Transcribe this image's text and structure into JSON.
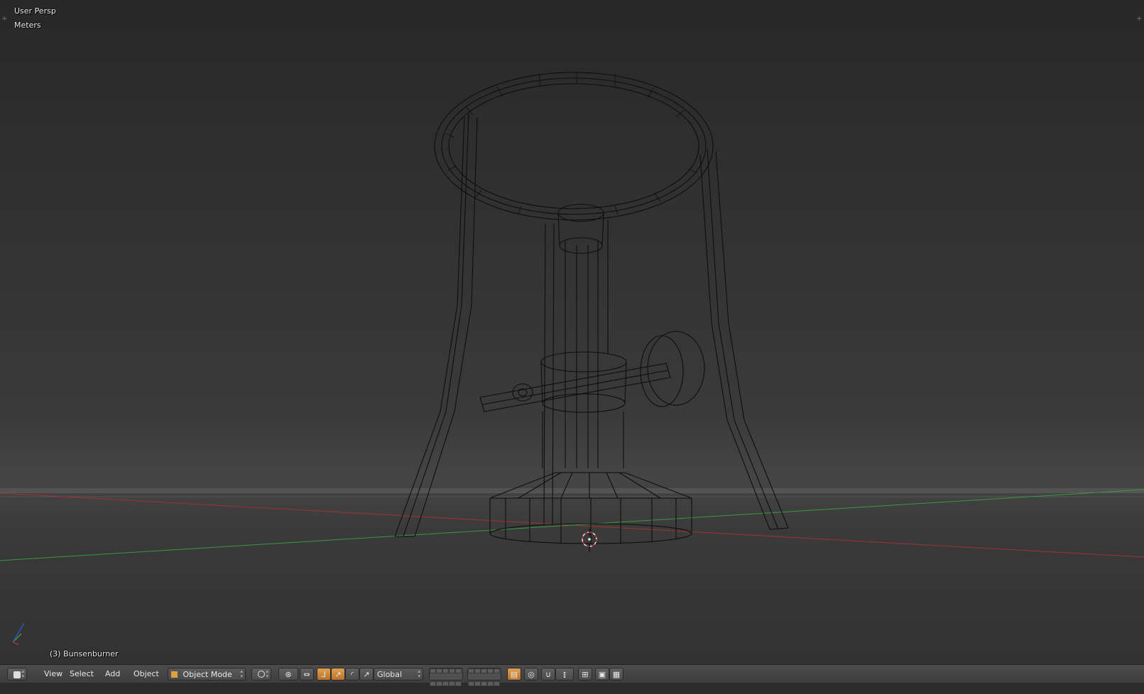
{
  "viewport": {
    "view_name": "User Persp",
    "units": "Meters",
    "selected_object": "(3) Bunsenburner",
    "axis_colors": {
      "x": "#b03030",
      "y": "#3fa03f",
      "z": "#3050c0"
    }
  },
  "header": {
    "editor_type_icon": "3d-viewport-icon",
    "menus": {
      "view": "View",
      "select": "Select",
      "add": "Add",
      "object": "Object"
    },
    "mode": {
      "label": "Object Mode",
      "icon": "cube-icon"
    },
    "viewport_shading_icon": "wireframe-sphere-icon",
    "pivot_icon": "pivot-point-icon",
    "manipulator_icons": [
      "manipulator-toggle-icon",
      "translate-icon",
      "rotate-icon",
      "scale-icon"
    ],
    "orientation": "Global",
    "snap_icons": [
      "snap-magnet-icon",
      "snap-target-icon"
    ],
    "accent_color": "#d08a3a"
  }
}
